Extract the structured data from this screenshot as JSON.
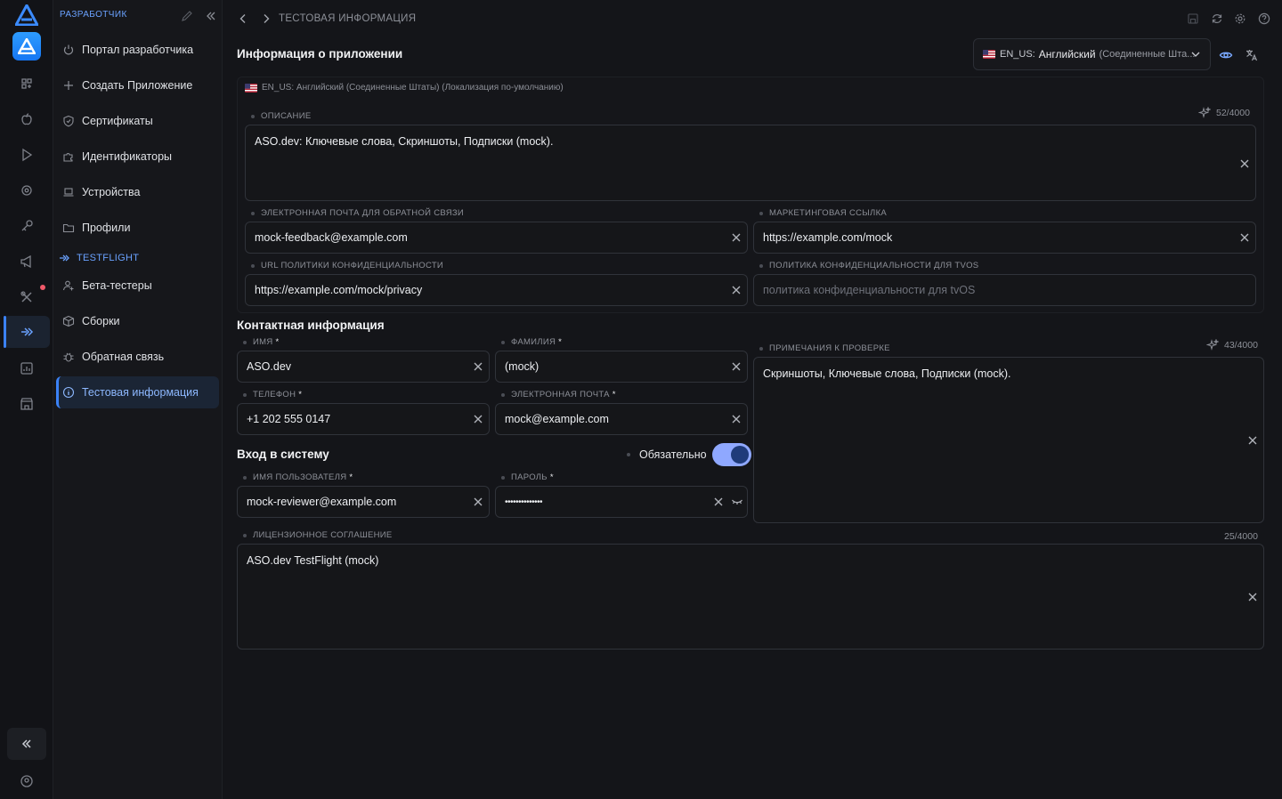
{
  "sidebar": {
    "header": "РАЗРАБОТЧИК",
    "items": [
      {
        "label": "Портал разработчика"
      },
      {
        "label": "Создать Приложение"
      },
      {
        "label": "Сертификаты"
      },
      {
        "label": "Идентификаторы"
      },
      {
        "label": "Устройства"
      },
      {
        "label": "Профили"
      }
    ],
    "section_testflight": "TESTFLIGHT",
    "tf_items": [
      {
        "label": "Бета-тестеры"
      },
      {
        "label": "Сборки"
      },
      {
        "label": "Обратная связь"
      },
      {
        "label": "Тестовая информация"
      }
    ]
  },
  "topbar": {
    "title": "ТЕСТОВАЯ ИНФОРМАЦИЯ"
  },
  "app_info": {
    "title": "Информация о приложении",
    "locale_select": {
      "code": "EN_US:",
      "language": "Английский",
      "region": "(Соединенные Шта..."
    },
    "locale_header": "EN_US: Английский (Соединенные Штаты) (Локализация по-умолчанию)",
    "description": {
      "label": "ОПИСАНИЕ",
      "value": "ASO.dev: Ключевые слова, Скриншоты, Подписки (mock).",
      "counter": "52/4000"
    },
    "feedback_email": {
      "label": "ЭЛЕКТРОННАЯ ПОЧТА ДЛЯ ОБРАТНОЙ СВЯЗИ",
      "value": "mock-feedback@example.com"
    },
    "marketing_url": {
      "label": "МАРКЕТИНГОВАЯ ССЫЛКА",
      "value": "https://example.com/mock"
    },
    "privacy_url": {
      "label": "URL ПОЛИТИКИ КОНФИДЕНЦИАЛЬНОСТИ",
      "value": "https://example.com/mock/privacy"
    },
    "tvos_privacy": {
      "label": "ПОЛИТИКА КОНФИДЕНЦИАЛЬНОСТИ ДЛЯ TVOS",
      "placeholder": "политика конфиденциальности для tvOS"
    }
  },
  "contact": {
    "title": "Контактная информация",
    "first_name": {
      "label": "ИМЯ",
      "value": "ASO.dev"
    },
    "last_name": {
      "label": "ФАМИЛИЯ",
      "value": "(mock)"
    },
    "phone": {
      "label": "ТЕЛЕФОН",
      "value": "+1 202 555 0147"
    },
    "email": {
      "label": "ЭЛЕКТРОННАЯ ПОЧТА",
      "value": "mock@example.com"
    },
    "required_mark": "*"
  },
  "review_notes": {
    "label": "ПРИМЕЧАНИЯ К ПРОВЕРКЕ",
    "value": "Скриншоты, Ключевые слова, Подписки (mock).",
    "counter": "43/4000"
  },
  "login": {
    "title": "Вход в систему",
    "required_toggle": "Обязательно",
    "required_on": true,
    "username": {
      "label": "ИМЯ ПОЛЬЗОВАТЕЛЯ",
      "value": "mock-reviewer@example.com"
    },
    "password": {
      "label": "ПАРОЛЬ",
      "value": "••••••••••••••"
    }
  },
  "license": {
    "label": "ЛИЦЕНЗИОННОЕ СОГЛАШЕНИЕ",
    "value": "ASO.dev TestFlight (mock)",
    "counter": "25/4000"
  },
  "colors": {
    "accent": "#3b82f6",
    "bg": "#141519",
    "toggle": "#8fa8ff"
  }
}
